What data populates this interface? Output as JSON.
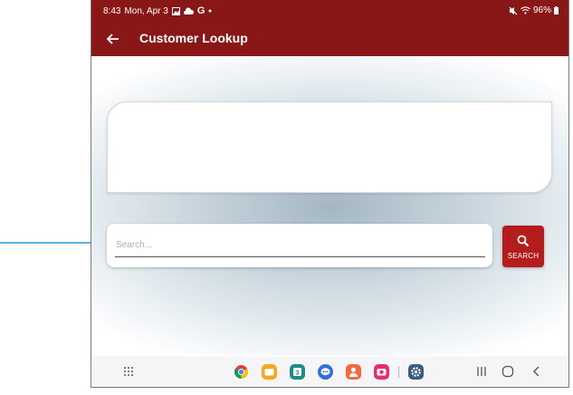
{
  "status_bar": {
    "time": "8:43",
    "date": "Mon, Apr 3",
    "notification_icons": [
      "image-icon",
      "cloud-icon",
      "google-icon",
      "dot-icon"
    ],
    "google_letter": "G",
    "system_icons": [
      "mute-icon",
      "wifi-icon",
      "battery-icon"
    ],
    "battery": "96%"
  },
  "app_bar": {
    "title": "Customer Lookup",
    "back_icon": "arrow-left-icon"
  },
  "search": {
    "placeholder": "Search...",
    "value": "",
    "button_label": "SEARCH",
    "button_icon": "magnifier-icon"
  },
  "nav_bar": {
    "apps_icon": "apps-grid-icon",
    "dock_apps": [
      {
        "name": "chrome-icon"
      },
      {
        "name": "folder-icon"
      },
      {
        "name": "calendar-icon",
        "text": "3"
      },
      {
        "name": "messages-icon"
      },
      {
        "name": "contacts-icon"
      },
      {
        "name": "camera-icon"
      },
      {
        "name": "settings-icon"
      }
    ],
    "system_buttons": [
      "recents-icon",
      "home-icon",
      "back-icon"
    ]
  },
  "colors": {
    "app_bar": "#8a1717",
    "search_button": "#b51c1c",
    "annotation_arrow": "#1e9be0"
  }
}
